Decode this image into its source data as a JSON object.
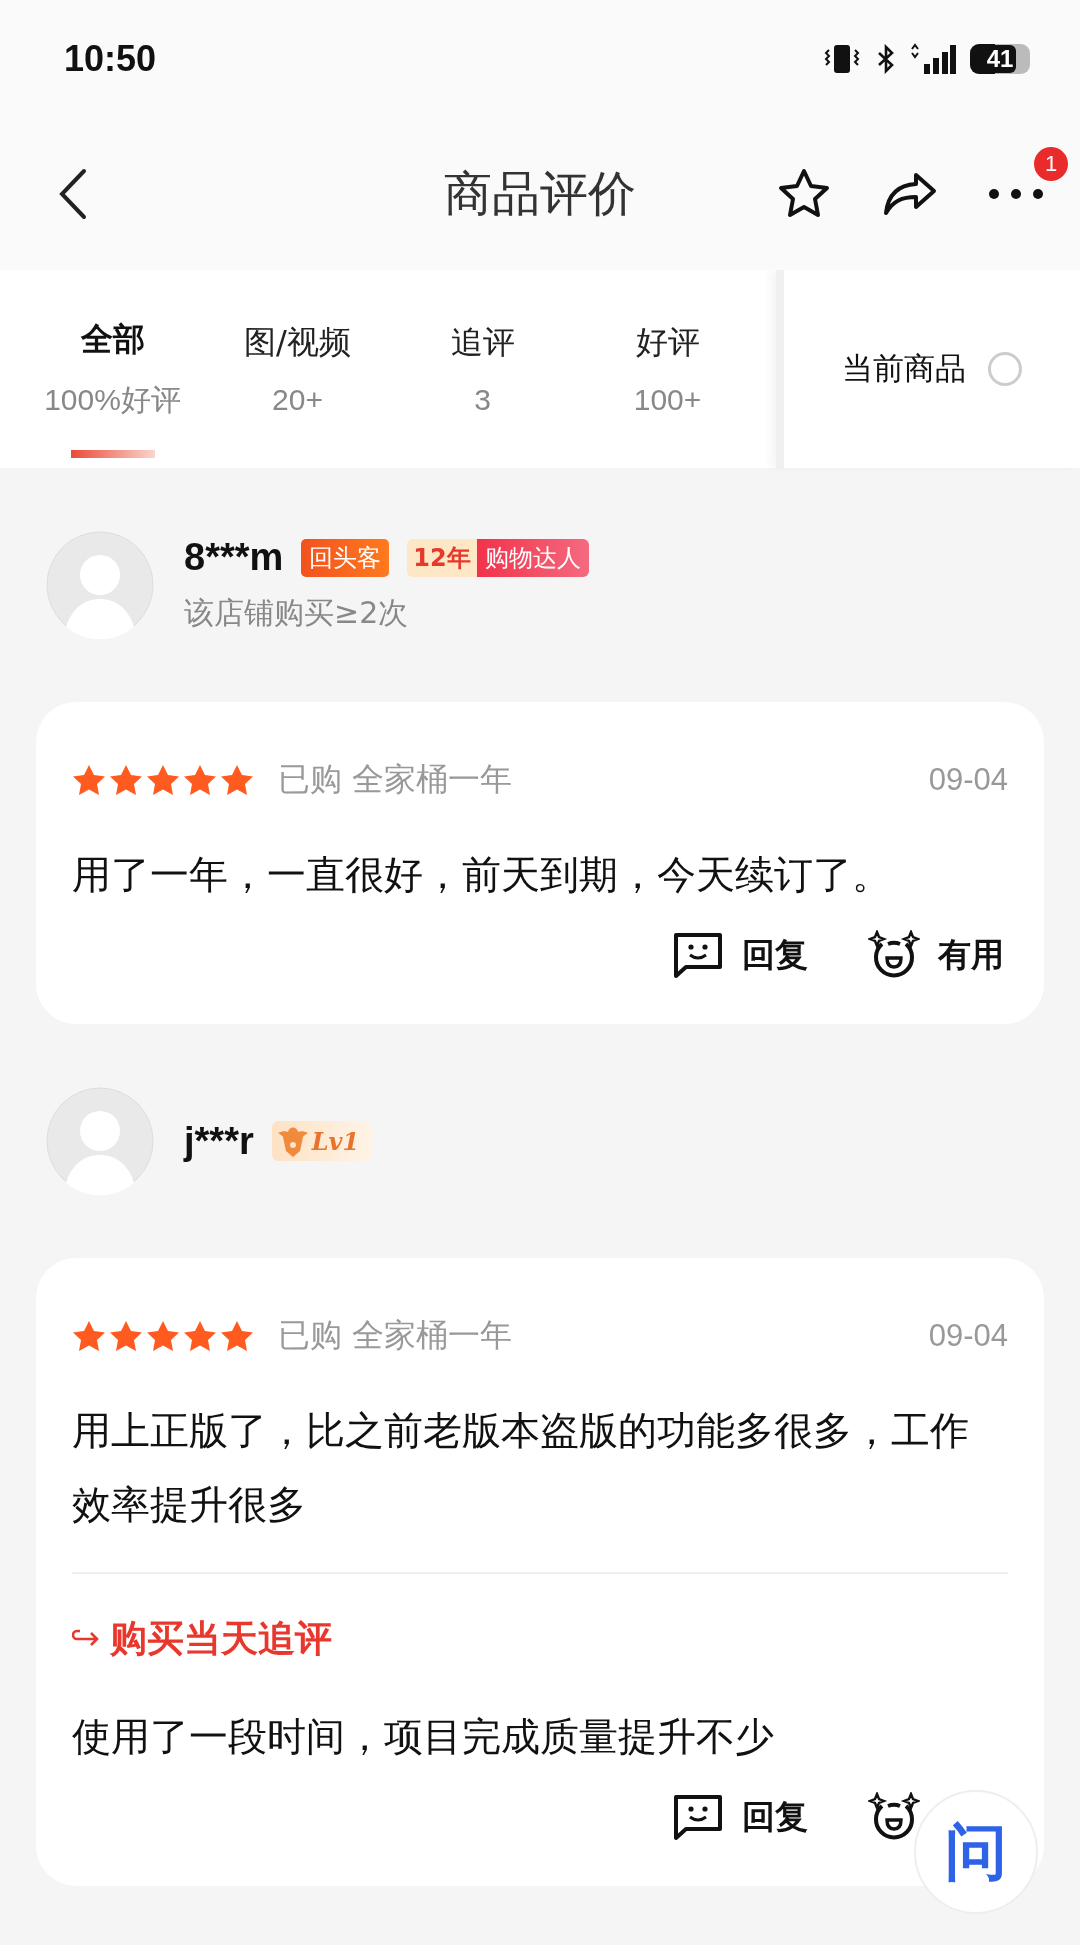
{
  "status_bar": {
    "time": "10:50",
    "battery": "41"
  },
  "header": {
    "title": "商品评价",
    "badge": "1"
  },
  "tabs": [
    {
      "label": "全部",
      "count": "100%好评",
      "selected": true
    },
    {
      "label": "图/视频",
      "count": "20+",
      "selected": false
    },
    {
      "label": "追评",
      "count": "3",
      "selected": false
    },
    {
      "label": "好评",
      "count": "100+",
      "selected": false
    }
  ],
  "filter": {
    "label": "当前商品",
    "checked": false
  },
  "reviews": [
    {
      "user": "8***m",
      "badges": [
        {
          "kind": "tag",
          "text": "回头客"
        },
        {
          "kind": "years",
          "years": "12年",
          "text": "购物达人"
        }
      ],
      "note": "该店铺购买≥2次",
      "stars": 5,
      "purchase": "已购 全家桶一年",
      "date": "09-04",
      "text": "用了一年，一直很好，前天到期，今天续订了。",
      "actions": [
        {
          "kind": "reply",
          "label": "回复"
        },
        {
          "kind": "useful",
          "label": "有用"
        }
      ]
    },
    {
      "user": "j***r",
      "badges": [
        {
          "kind": "level",
          "text": "Lv1"
        }
      ],
      "stars": 5,
      "purchase": "已购 全家桶一年",
      "date": "09-04",
      "text": "用上正版了，比之前老版本盗版的功能多很多，工作效率提升很多",
      "followup": {
        "title": "购买当天追评",
        "text": "使用了一段时间，项目完成质量提升不少"
      },
      "actions": [
        {
          "kind": "reply",
          "label": "回复"
        },
        {
          "kind": "useful"
        }
      ]
    }
  ],
  "float_button": {
    "label": "问"
  }
}
